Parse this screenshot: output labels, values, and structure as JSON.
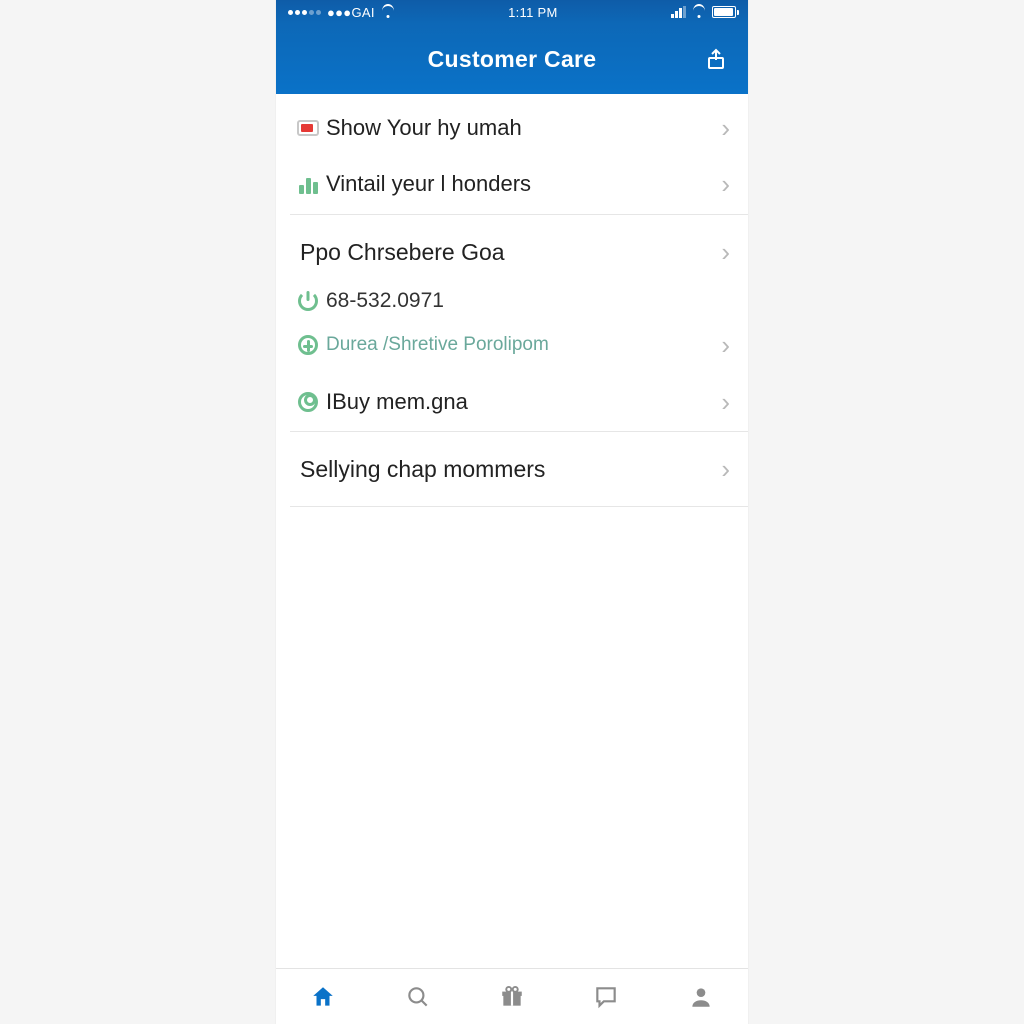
{
  "status": {
    "carrier": "●●●GAI",
    "time": "1:11 PM"
  },
  "header": {
    "title": "Customer Care"
  },
  "group1": {
    "items": [
      {
        "icon": "card",
        "label": "Show Your hy umah"
      },
      {
        "icon": "bars",
        "label": "Vintail yeur l honders"
      }
    ]
  },
  "group2": {
    "title": "Ppo Chrsebere Goa",
    "phone": {
      "icon": "power",
      "label": "68-532.0971"
    },
    "sub": {
      "icon": "globe",
      "label": "Durea /Shretive Porolipom"
    },
    "buy": {
      "icon": "ring",
      "label": "IBuy mem.gna"
    }
  },
  "group3": {
    "title": "Sellying chap mommers"
  },
  "tabs": {
    "home": "home",
    "search": "search",
    "gift": "gift",
    "chat": "chat",
    "profile": "profile"
  }
}
